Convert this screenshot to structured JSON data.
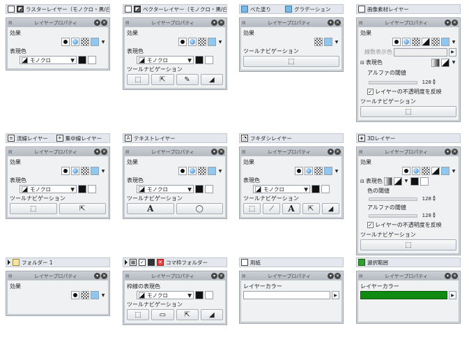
{
  "panel_title": "レイヤープロパティ",
  "labels": {
    "effect": "効果",
    "color_mode": "表現色",
    "tool_nav": "ツールナビゲーション",
    "mono": "モノクロ",
    "line_color_label": "線数表示色",
    "alpha_threshold": "アルファの閾値",
    "color_threshold": "色の閾値",
    "invert_opacity": "レイヤーの不透明度を反映",
    "frame_color": "枠線の表現色",
    "layer_color": "レイヤーカラー",
    "value_128": "128"
  },
  "cells": {
    "raster": "ラスターレイヤー（モノクロ・黒/白）",
    "vector": "ベクターレイヤー（モノクロ・黒/白）",
    "fill": "べた塗り",
    "gradient": "グラデーション",
    "image_material": "画像素材レイヤー",
    "speed_line": "流線レイヤー",
    "focus_line": "集中線レイヤー",
    "text": "テキストレイヤー",
    "balloon": "フキダシレイヤー",
    "threed": "3Dレイヤー",
    "folder": "フォルダー 1",
    "frame_folder": "コマ枠フォルダー",
    "paper": "用紙",
    "selection": "選択範囲"
  },
  "accent": {
    "layer_color_green": "#108a10",
    "titlebar": "#c0c5cc"
  }
}
